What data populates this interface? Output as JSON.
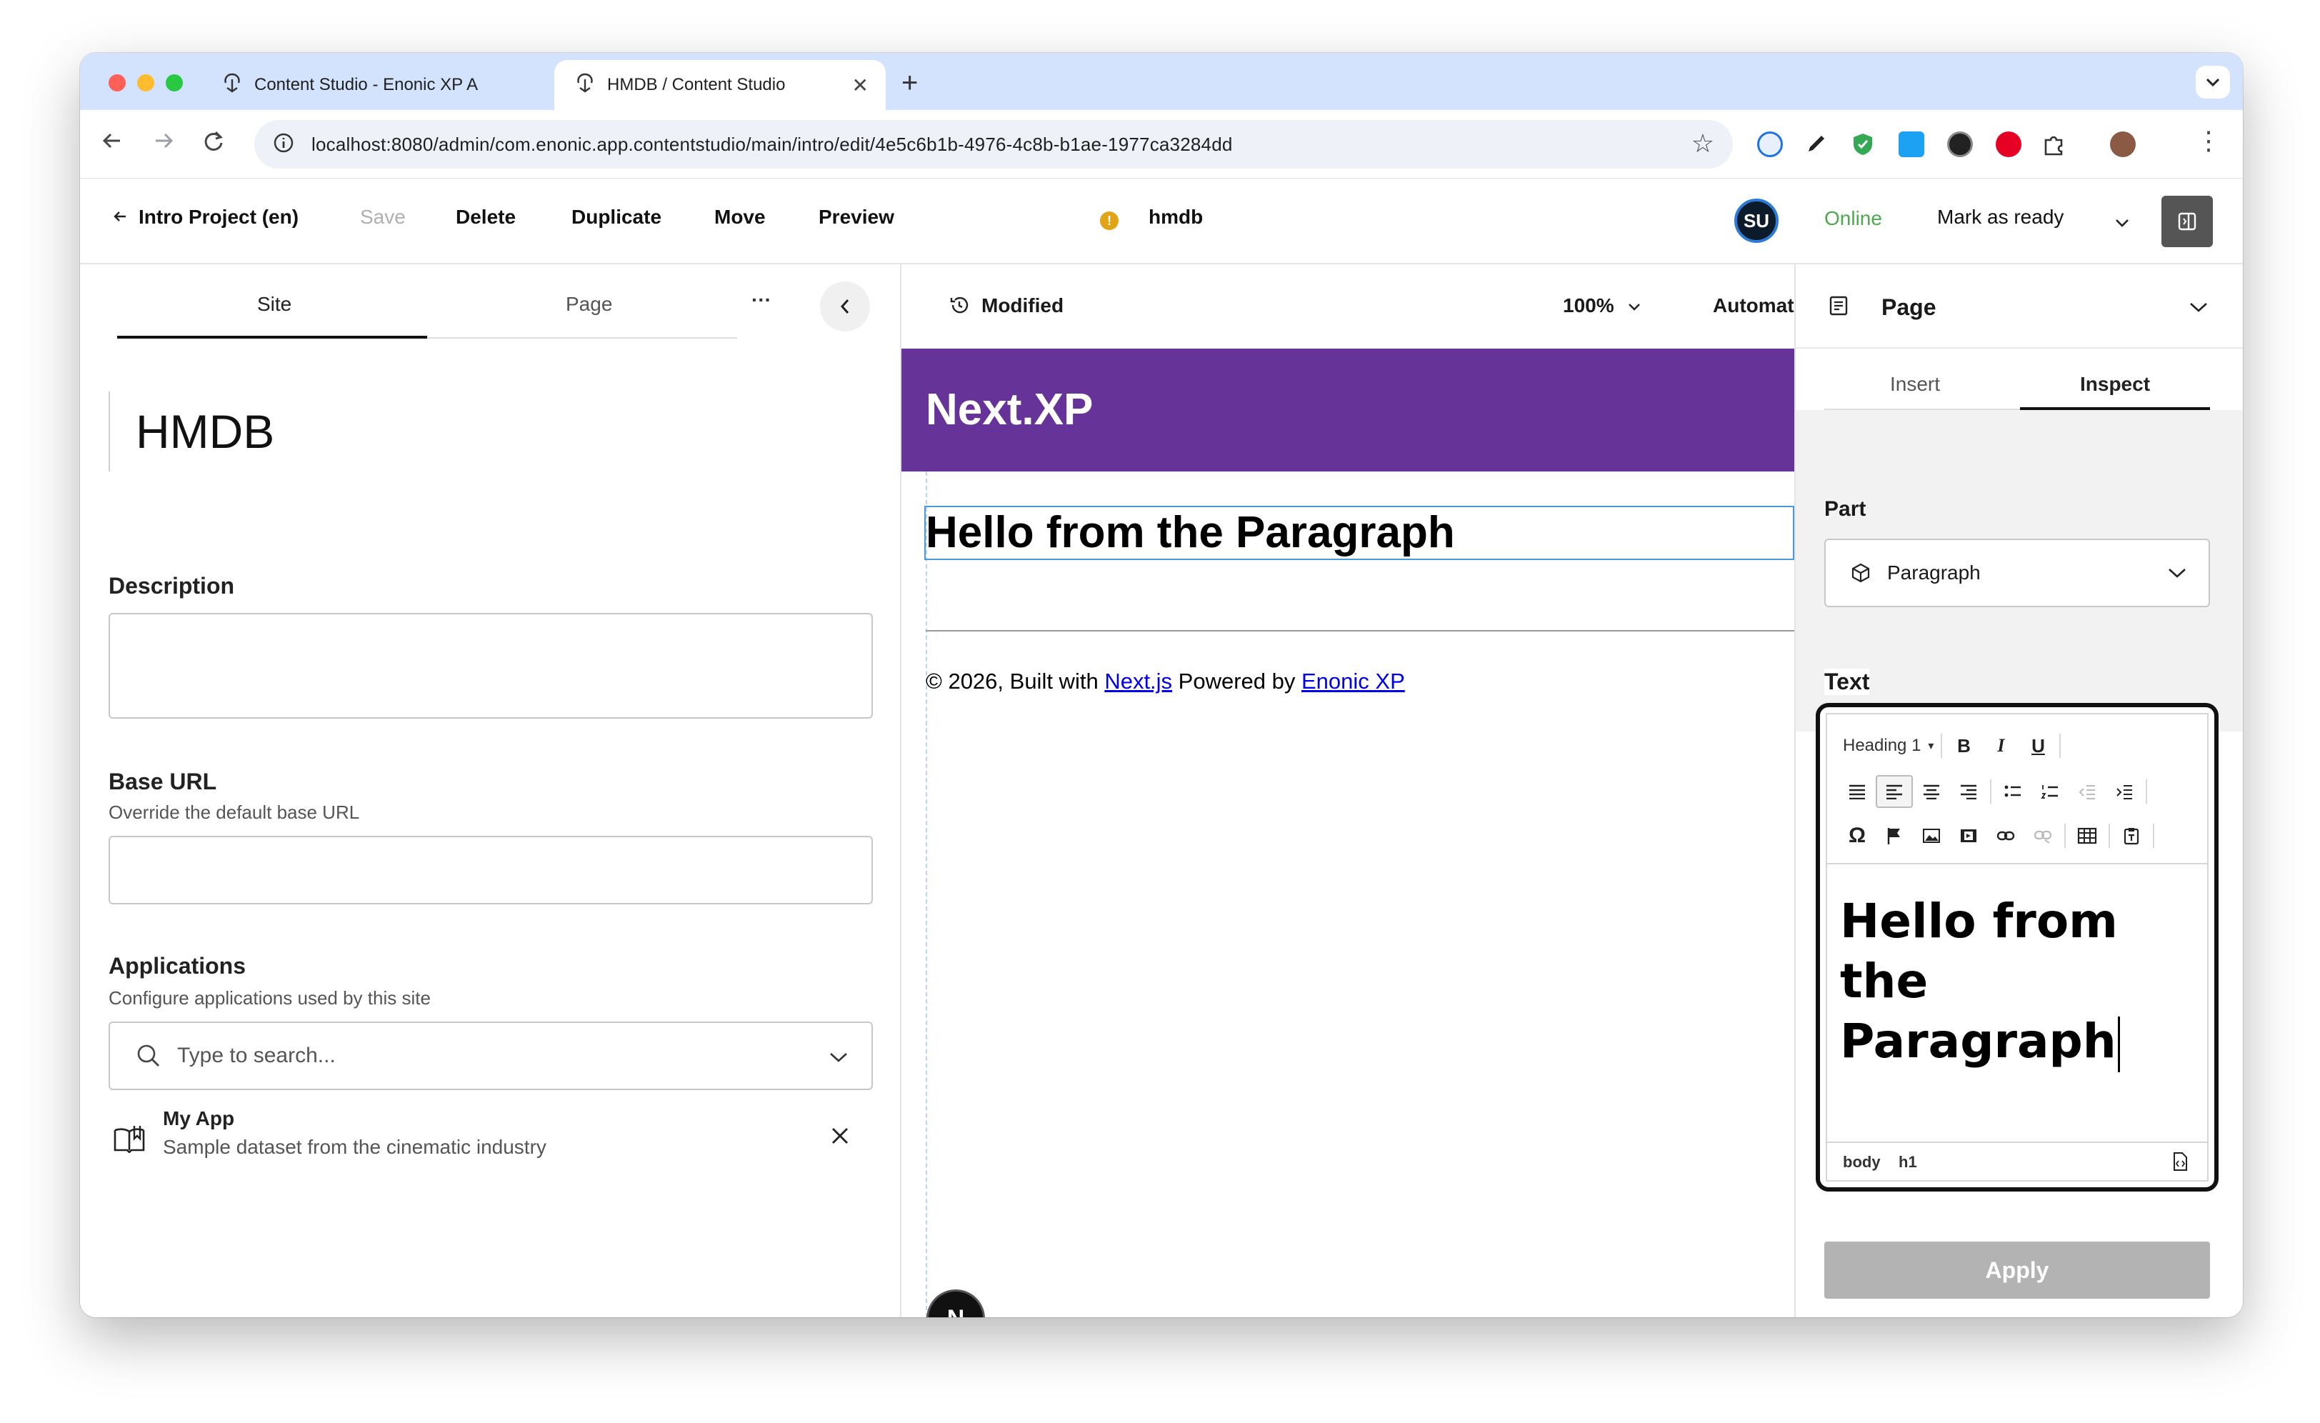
{
  "browser": {
    "tabs": [
      {
        "title": "Content Studio - Enonic XP A",
        "active": false
      },
      {
        "title": "HMDB / Content Studio",
        "active": true
      }
    ],
    "new_tab_label": "+",
    "url": "localhost:8080/admin/com.enonic.app.contentstudio/main/intro/edit/4e5c6b1b-4976-4c8b-b1ae-1977ca3284dd",
    "icons": [
      "back-icon",
      "forward-icon",
      "reload-icon",
      "site-info-icon",
      "bookmark-star-icon",
      "extension-icons",
      "profile-avatar",
      "more-menu-icon"
    ]
  },
  "appbar": {
    "back_label": "Intro Project (en)",
    "save_label": "Save",
    "delete_label": "Delete",
    "duplicate_label": "Duplicate",
    "move_label": "Move",
    "preview_label": "Preview",
    "warning_glyph": "!",
    "content_name": "hmdb",
    "user_initials": "SU",
    "status_label": "Online",
    "workflow_label": "Mark as ready",
    "colors": {
      "online": "#4caa4c",
      "warning": "#e1a416"
    }
  },
  "leftpanel": {
    "tabs": [
      "Site",
      "Page"
    ],
    "more_label": "···",
    "site_title": "HMDB",
    "description": {
      "label": "Description",
      "value": ""
    },
    "base_url": {
      "label": "Base URL",
      "help": "Override the default base URL",
      "value": ""
    },
    "applications": {
      "label": "Applications",
      "help": "Configure applications used by this site",
      "placeholder": "Type to search...",
      "items": [
        {
          "name": "My App",
          "description": "Sample dataset from the cinematic industry"
        }
      ]
    }
  },
  "center": {
    "status_label": "Modified",
    "zoom_label": "100%",
    "device_label": "Automatic",
    "preview": {
      "logo": "Next.XP",
      "paragraph_text": "Hello from the Paragraph",
      "footer_prefix": "© 2026, Built with ",
      "footer_link1": "Next.js",
      "footer_middle": " Powered by ",
      "footer_link2": "Enonic XP",
      "badge_letter": "N",
      "header_color": "#663399"
    }
  },
  "rightpanel": {
    "title": "Page",
    "tabs": [
      "Insert",
      "Inspect"
    ],
    "part_label": "Part",
    "part_value": "Paragraph",
    "text_label": "Text",
    "format_select": "Heading 1",
    "format_chevron": "▾",
    "bold": "B",
    "italic": "I",
    "underline": "U",
    "omega": "Ω",
    "editor_line1": "Hello from the",
    "editor_line2": "Paragraph",
    "path": [
      "body",
      "h1"
    ],
    "apply_label": "Apply"
  }
}
